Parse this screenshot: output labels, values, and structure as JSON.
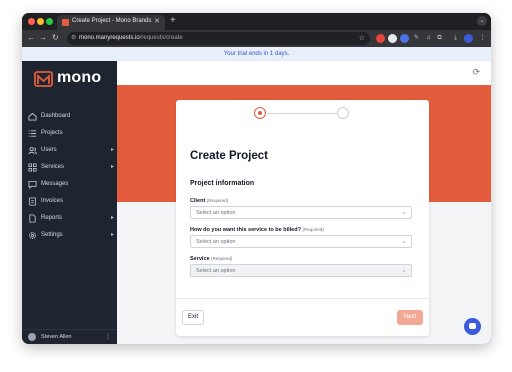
{
  "browser": {
    "tab_title": "Create Project - Mono Brands",
    "tab_close": "✕",
    "new_tab": "+",
    "url_host": "mono.manyrequests.io",
    "url_path": "/requests/create"
  },
  "banner": {
    "text": "Your trial ends in 1 days."
  },
  "brand": {
    "name": "mono",
    "color": "#e35d3c"
  },
  "sidebar": {
    "items": [
      {
        "label": "Dashboard",
        "icon": "home-icon",
        "has_submenu": false
      },
      {
        "label": "Projects",
        "icon": "list-icon",
        "has_submenu": false
      },
      {
        "label": "Users",
        "icon": "users-icon",
        "has_submenu": true
      },
      {
        "label": "Services",
        "icon": "grid-icon",
        "has_submenu": true
      },
      {
        "label": "Messages",
        "icon": "message-icon",
        "has_submenu": false
      },
      {
        "label": "Invoices",
        "icon": "invoice-icon",
        "has_submenu": false
      },
      {
        "label": "Reports",
        "icon": "document-icon",
        "has_submenu": true
      },
      {
        "label": "Settings",
        "icon": "gear-icon",
        "has_submenu": true
      }
    ],
    "caret": "▸",
    "user": {
      "name": "Steven Allen",
      "menu": "⋮"
    }
  },
  "card": {
    "title": "Create Project",
    "section": "Project information",
    "fields": [
      {
        "label": "Client",
        "required": "(Required)",
        "placeholder": "Select an option",
        "disabled": false
      },
      {
        "label": "How do you want this service to be billed?",
        "required": "(Required)",
        "placeholder": "Select an option",
        "disabled": false
      },
      {
        "label": "Service",
        "required": "(Required)",
        "placeholder": "Select an option",
        "disabled": true
      }
    ],
    "exit_label": "Exit",
    "next_label": "Next"
  },
  "colors": {
    "accent": "#e35d3c",
    "sidebar_bg": "#1e2530",
    "link": "#2f57c9",
    "chat": "#3b5bdb"
  }
}
